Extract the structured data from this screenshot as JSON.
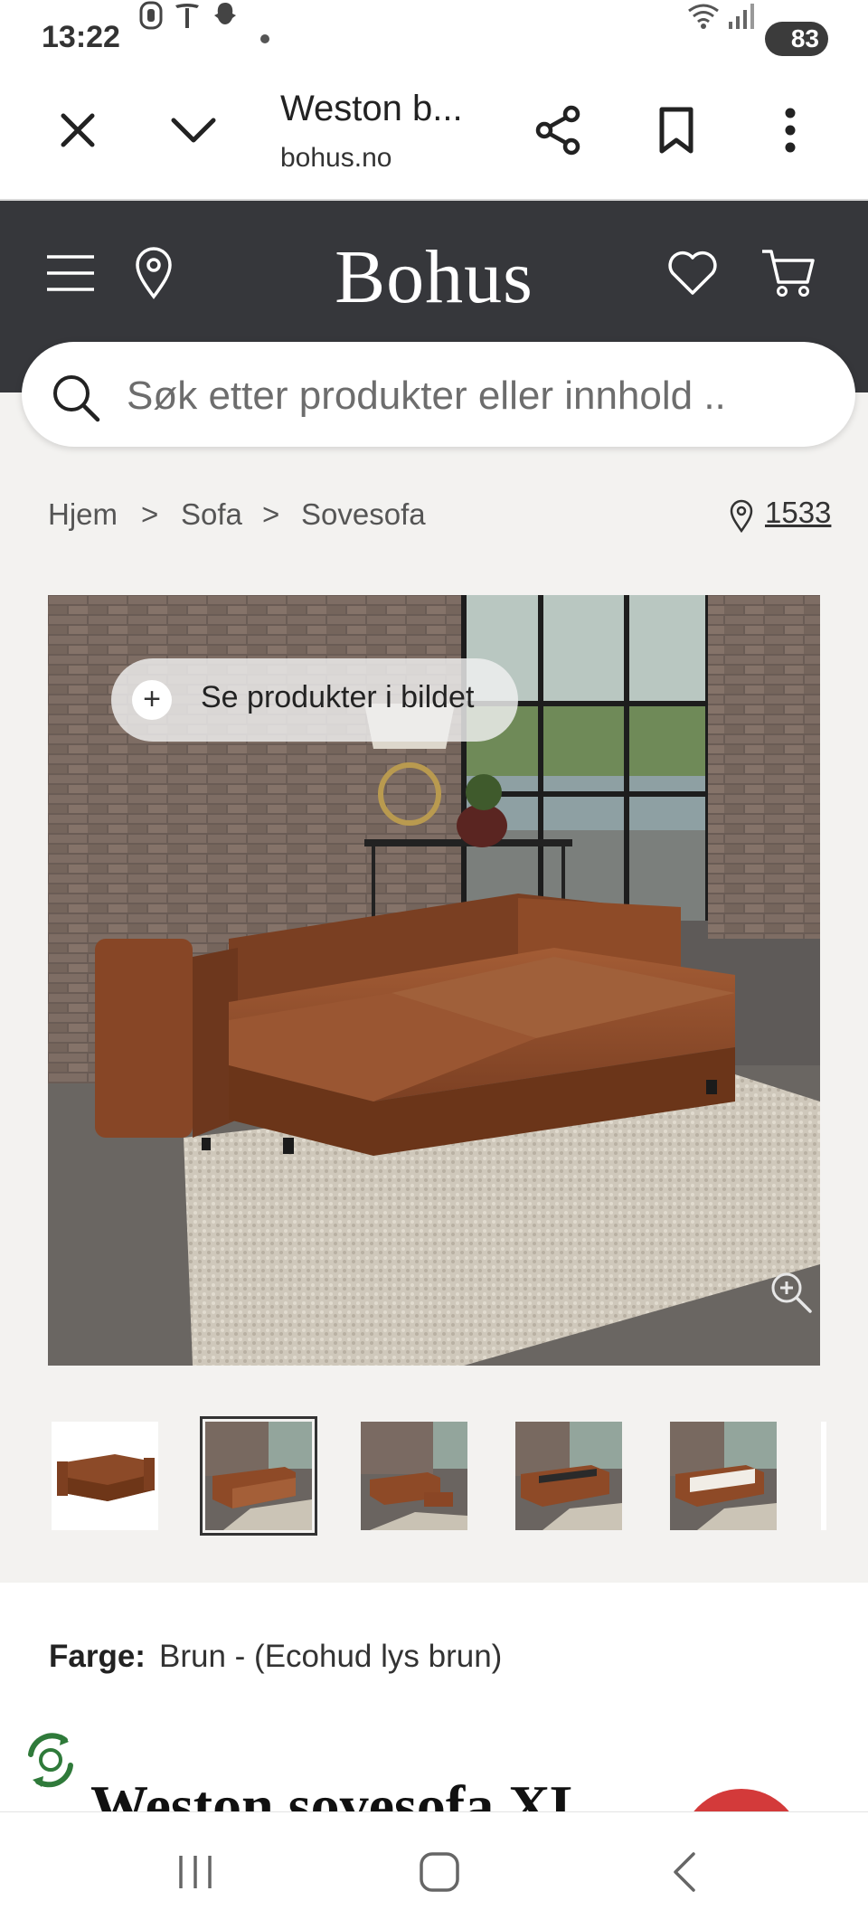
{
  "status": {
    "time": "13:22",
    "battery": "83",
    "icons": [
      "privacy-icon",
      "tesla-icon",
      "snapchat-icon",
      "dot-icon",
      "wifi-icon",
      "signal-icon"
    ]
  },
  "browser": {
    "page_title": "Weston b...",
    "url": "bohus.no"
  },
  "site": {
    "logo": "Bohus"
  },
  "search": {
    "placeholder": "Søk etter produkter eller innhold .."
  },
  "breadcrumb": {
    "items": [
      "Hjem",
      "Sofa",
      "Sovesofa"
    ],
    "separator": ">",
    "store_code": "1533"
  },
  "gallery": {
    "pill_label": "Se produkter i bildet",
    "thumbnails_count": 5,
    "selected_index": 1
  },
  "product": {
    "color_label": "Farge:",
    "color_value": "Brun - (Ecohud lys brun)",
    "title": "Weston sovesofa XL"
  },
  "colors": {
    "header_bg": "#36373b",
    "page_bg": "#f3f2f0",
    "sofa_brown": "#8a4a2a",
    "accent_red": "#d33a3a"
  }
}
